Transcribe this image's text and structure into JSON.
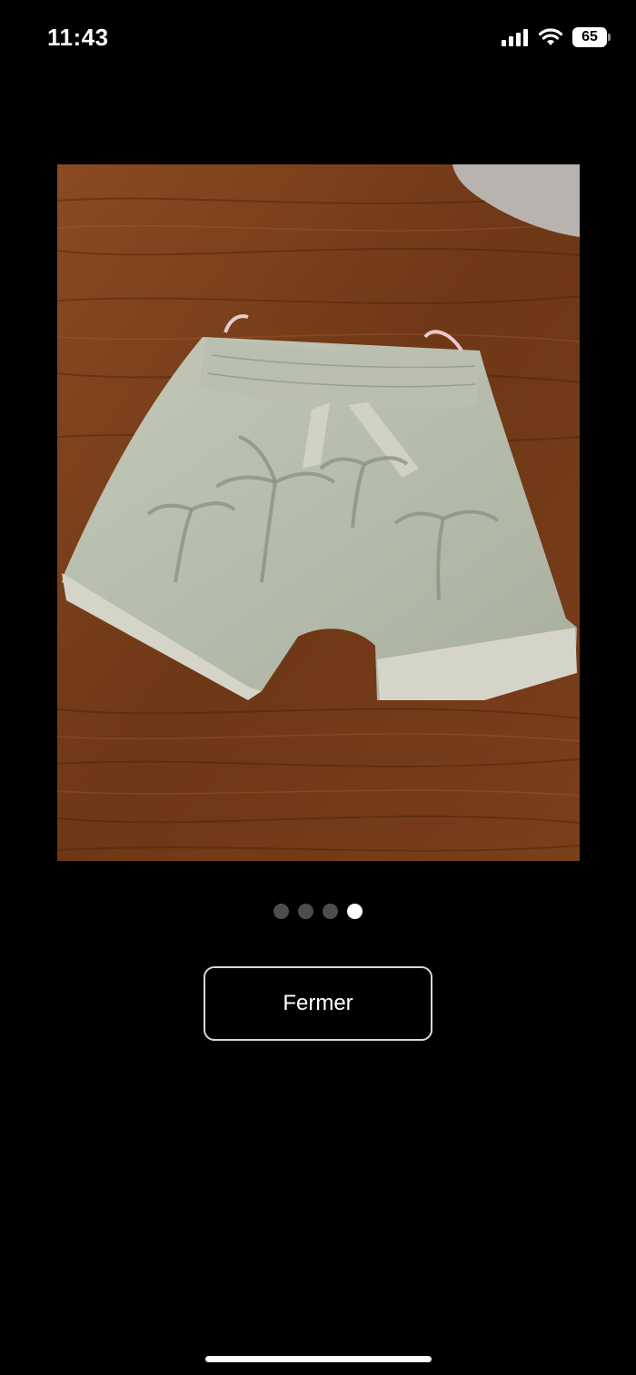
{
  "status_bar": {
    "time": "11:43",
    "battery_level": "65",
    "icons": [
      "signal-icon",
      "wifi-icon",
      "battery-icon"
    ]
  },
  "viewer": {
    "image_alt": "",
    "pages_total": 4,
    "current_page": 4
  },
  "actions": {
    "close_label": "Fermer"
  },
  "colors": {
    "background": "#000000",
    "text": "#ffffff",
    "dot_inactive": "#4d4d4d",
    "dot_active": "#ffffff",
    "button_border": "#d9d9d9"
  }
}
